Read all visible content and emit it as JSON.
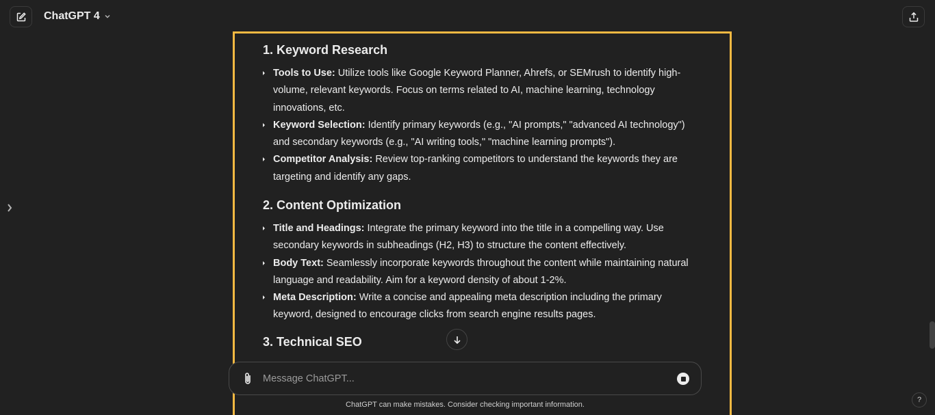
{
  "header": {
    "model_name": "ChatGPT 4",
    "new_chat_icon": "compose-icon",
    "share_icon": "share-icon"
  },
  "sections": [
    {
      "heading": "1. Keyword Research",
      "bullets": [
        {
          "label": "Tools to Use:",
          "text": " Utilize tools like Google Keyword Planner, Ahrefs, or SEMrush to identify high-volume, relevant keywords. Focus on terms related to AI, machine learning, technology innovations, etc."
        },
        {
          "label": "Keyword Selection:",
          "text": " Identify primary keywords (e.g., \"AI prompts,\" \"advanced AI technology\") and secondary keywords (e.g., \"AI writing tools,\" \"machine learning prompts\")."
        },
        {
          "label": "Competitor Analysis:",
          "text": " Review top-ranking competitors to understand the keywords they are targeting and identify any gaps."
        }
      ]
    },
    {
      "heading": "2. Content Optimization",
      "bullets": [
        {
          "label": "Title and Headings:",
          "text": " Integrate the primary keyword into the title in a compelling way. Use secondary keywords in subheadings (H2, H3) to structure the content effectively."
        },
        {
          "label": "Body Text:",
          "text": " Seamlessly incorporate keywords throughout the content while maintaining natural language and readability. Aim for a keyword density of about 1-2%."
        },
        {
          "label": "Meta Description:",
          "text": " Write a concise and appealing meta description including the primary keyword, designed to encourage clicks from search engine results pages."
        }
      ]
    },
    {
      "heading": "3. Technical SEO",
      "bullets": []
    }
  ],
  "composer": {
    "placeholder": "Message ChatGPT..."
  },
  "footer": {
    "disclaimer": "ChatGPT can make mistakes. Consider checking important information.",
    "help_label": "?"
  },
  "colors": {
    "background": "#212121",
    "text": "#ececec",
    "highlight": "#f5b942"
  }
}
